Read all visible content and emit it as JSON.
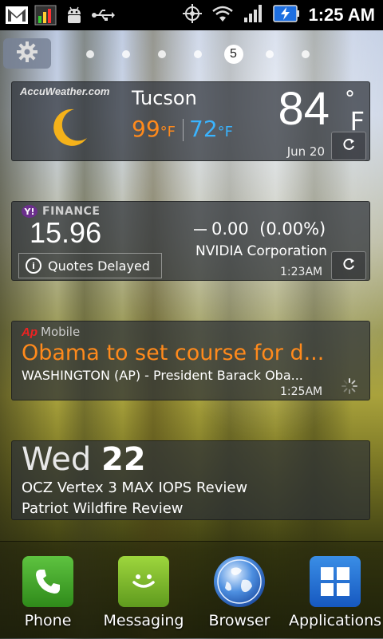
{
  "statusbar": {
    "time": "1:25 AM",
    "left_icons": [
      "gmail-icon",
      "chart-icon",
      "android-icon",
      "usb-icon"
    ],
    "right_icons": [
      "gps-icon",
      "wifi-icon",
      "signal-icon",
      "battery-charging-icon"
    ]
  },
  "home": {
    "active_page": "5",
    "page_count": 7
  },
  "weather": {
    "provider": "AccuWeather.com",
    "city": "Tucson",
    "high": "99",
    "low": "72",
    "unit": "F",
    "temp": "84",
    "date": "Jun 20",
    "condition_icon": "moon-icon"
  },
  "finance": {
    "provider": "FINANCE",
    "price": "15.96",
    "quotes_note": "Quotes Delayed",
    "change": "0.00",
    "change_pct": "(0.00%)",
    "company": "NVIDIA Corporation",
    "time": "1:23AM"
  },
  "news": {
    "source": "Mobile",
    "source_logo": "Ap",
    "headline": "Obama to set course for d...",
    "summary": "WASHINGTON (AP) - President Barack Oba...",
    "time": "1:25AM"
  },
  "calendar": {
    "weekday": "Wed",
    "day": "22",
    "events": [
      "OCZ Vertex 3 MAX IOPS Review",
      "Patriot Wildfire Review"
    ]
  },
  "dock": {
    "items": [
      {
        "label": "Phone",
        "icon": "phone-icon"
      },
      {
        "label": "Messaging",
        "icon": "messaging-icon"
      },
      {
        "label": "Browser",
        "icon": "browser-icon"
      },
      {
        "label": "Applications",
        "icon": "applications-icon"
      }
    ]
  },
  "colors": {
    "high_temp": "#ff8a1c",
    "low_temp": "#3ab4ff",
    "headline": "#ff8a1c",
    "ap_red": "#e22222"
  }
}
